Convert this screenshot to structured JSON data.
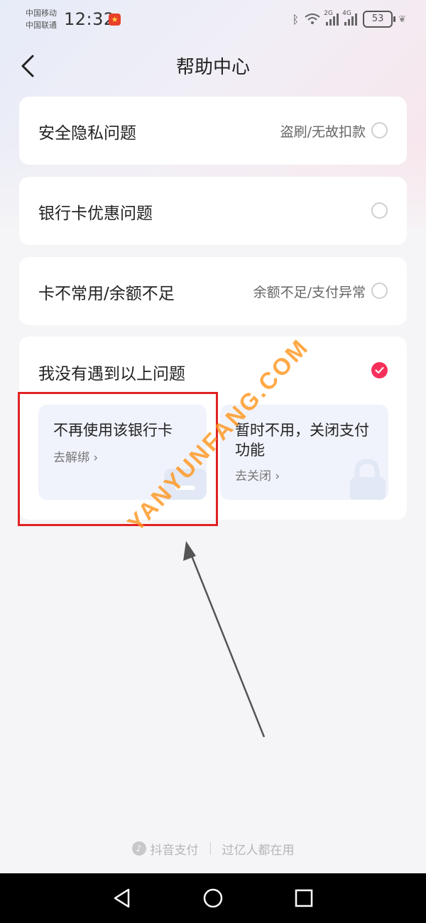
{
  "status_bar": {
    "carrier_1": "中国移动",
    "carrier_2": "中国联通",
    "time": "12:32",
    "net_1": "2G",
    "net_2": "4G",
    "battery": "53"
  },
  "header": {
    "title": "帮助中心"
  },
  "options": [
    {
      "label": "安全隐私问题",
      "hint": "盗刷/无故扣款",
      "selected": false
    },
    {
      "label": "银行卡优惠问题",
      "hint": "",
      "selected": false
    },
    {
      "label": "卡不常用/余额不足",
      "hint": "余额不足/支付异常",
      "selected": false
    },
    {
      "label": "我没有遇到以上问题",
      "hint": "",
      "selected": true
    }
  ],
  "sub_options": [
    {
      "title": "不再使用该银行卡",
      "link": "去解绑 ›"
    },
    {
      "title": "暂时不用，关闭支付功能",
      "link": "去关闭 ›"
    }
  ],
  "watermark": "YANYUNFANG.COM",
  "footer": {
    "brand": "抖音支付",
    "slogan": "过亿人都在用"
  },
  "colors": {
    "accent": "#f5305a",
    "highlight": "#e02323",
    "watermark": "#ff961e"
  }
}
